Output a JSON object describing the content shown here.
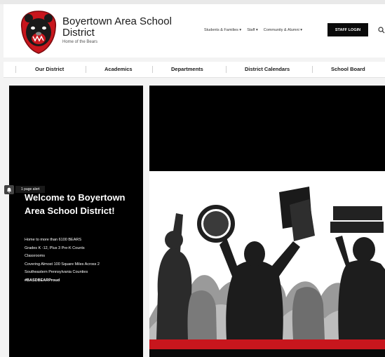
{
  "header": {
    "school_name": "Boyertown Area School District",
    "tagline": "Home of the Bears",
    "utility_nav": [
      "Students & Families ▾",
      "Staff ▾",
      "Community & Alumni ▾"
    ],
    "staff_login_label": "STAFF LOGIN",
    "search_icon": "search-icon"
  },
  "main_nav": {
    "items": [
      "Our District",
      "Academics",
      "Departments",
      "District Calendars",
      "School Board"
    ]
  },
  "hero": {
    "title": "Welcome to Boyertown Area School District!",
    "lines": [
      "Home to more than 6100 BEARS",
      "Grades K -12, Plus 3 Pre-K Counts",
      "Classrooms",
      "Covering Almost 100 Square Miles Across 2",
      "Southeastern Pennsylvania Counties"
    ],
    "hashtag": "#BASDBEARProud"
  },
  "alert": {
    "label": "1 page alert",
    "icon": "bell-icon"
  },
  "colors": {
    "brand_red": "#c8161d",
    "black": "#000000",
    "white": "#ffffff"
  }
}
